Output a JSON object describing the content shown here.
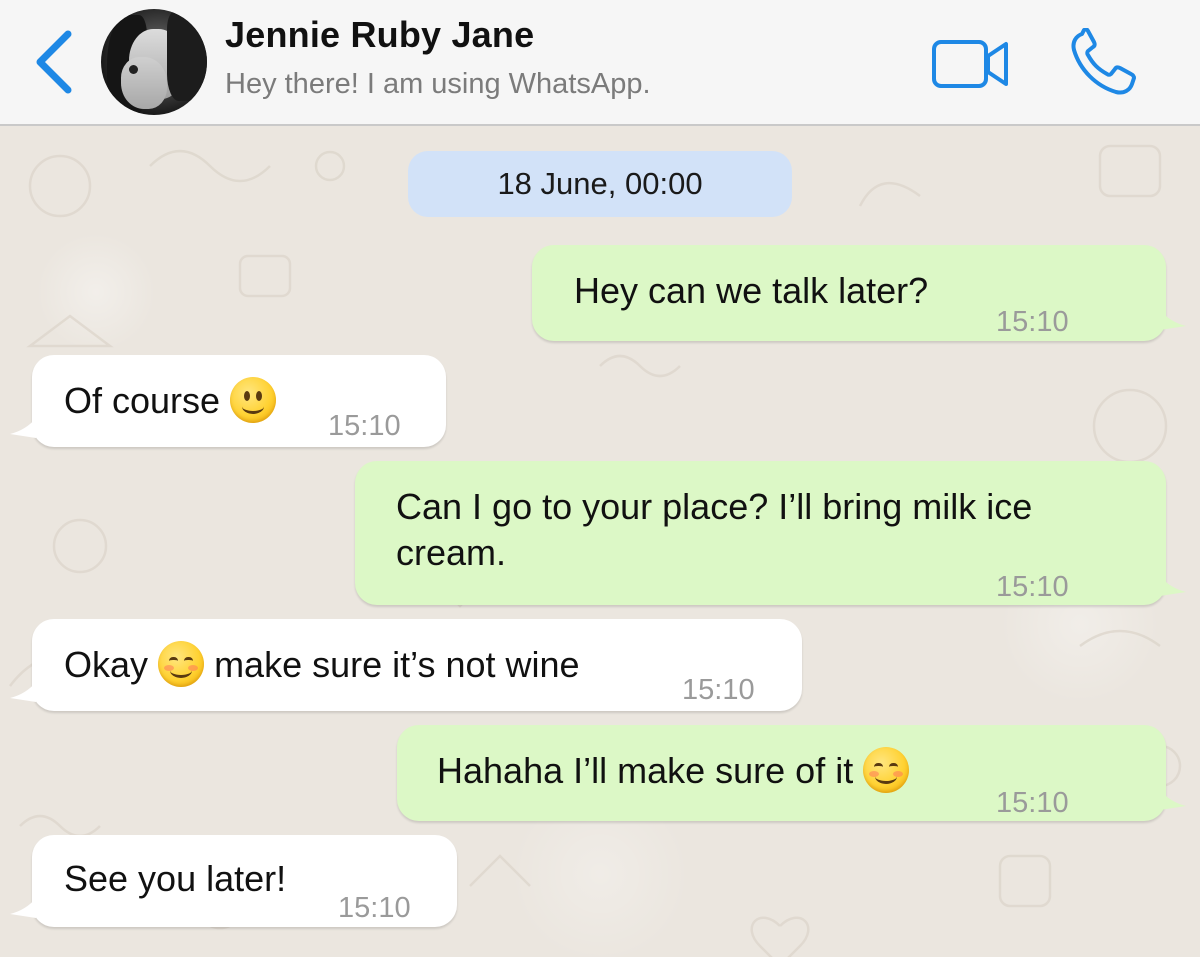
{
  "header": {
    "contact_name": "Jennie Ruby Jane",
    "contact_status": "Hey there! I am using WhatsApp.",
    "back_icon": "chevron-left-icon",
    "video_icon": "video-camera-icon",
    "call_icon": "phone-icon",
    "accent_color": "#1e88e5"
  },
  "chat": {
    "date_label": "18 June, 00:00",
    "messages": [
      {
        "direction": "outgoing",
        "text": "Hey can we talk later?",
        "time": "15:10"
      },
      {
        "direction": "incoming",
        "text": "Of course",
        "emoji": "slightly-smiling-face",
        "time": "15:10"
      },
      {
        "direction": "outgoing",
        "text_line1": "Can I go to your place? I’ll bring milk ice",
        "text_line2": "cream.",
        "time": "15:10"
      },
      {
        "direction": "incoming",
        "text_before": "Okay",
        "emoji": "smiling-face-with-smiling-eyes",
        "text_after": "make sure it’s not wine",
        "time": "15:10"
      },
      {
        "direction": "outgoing",
        "text": "Hahaha I’ll make sure of it",
        "emoji": "smiling-face-with-smiling-eyes",
        "time": "15:10"
      },
      {
        "direction": "incoming",
        "text": "See you later!",
        "time": "15:10"
      }
    ]
  },
  "colors": {
    "outgoing_bubble": "#dcf8c6",
    "incoming_bubble": "#ffffff",
    "date_pill": "#d2e2f8",
    "chat_background": "#ebe6df"
  }
}
